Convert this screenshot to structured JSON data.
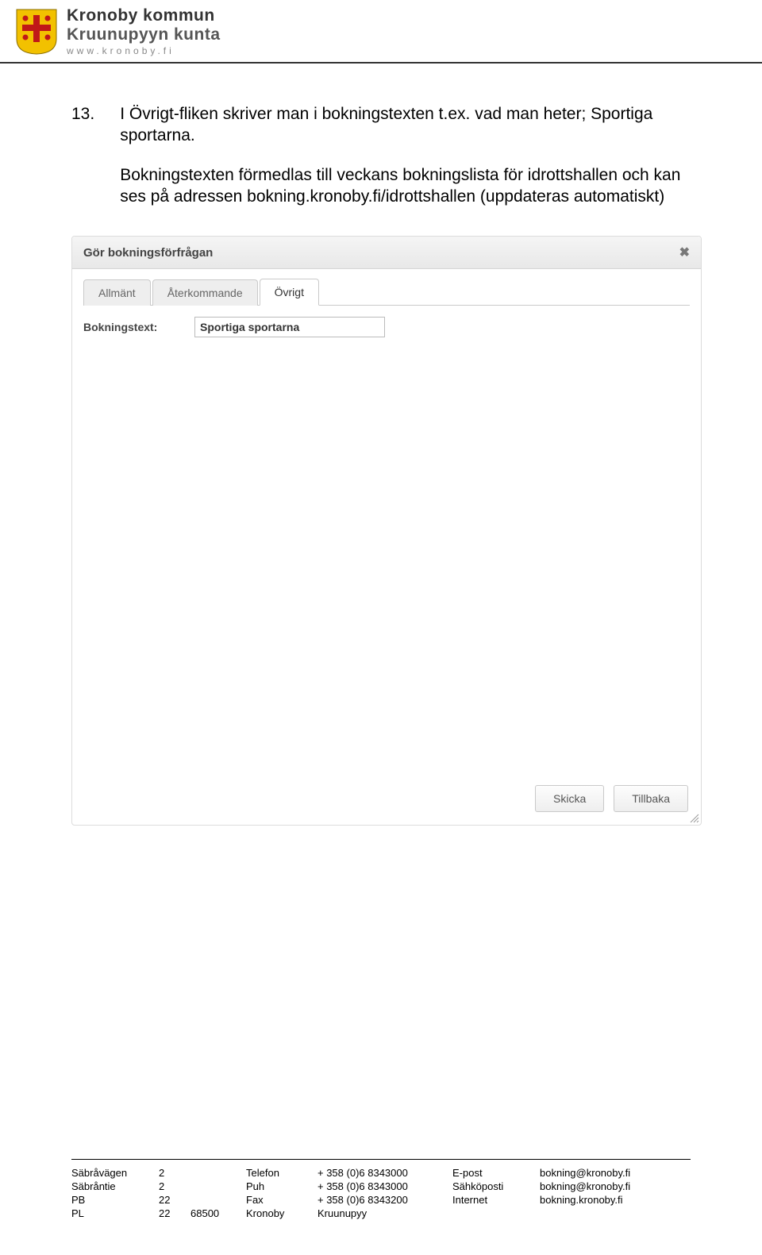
{
  "header": {
    "org_line1": "Kronoby kommun",
    "org_line2": "Kruunupyyn kunta",
    "url_spaced": "www.kronoby.fi"
  },
  "instruction": {
    "number": "13.",
    "para1": "I Övrigt-fliken skriver man i bokningstexten t.ex. vad man heter; Sportiga sportarna.",
    "para2": "Bokningstexten förmedlas till veckans bokningslista för idrottshallen och kan ses på adressen bokning.kronoby.fi/idrottshallen (uppdateras automatiskt)"
  },
  "dialog": {
    "title": "Gör bokningsförfrågan",
    "close_glyph": "✖",
    "tabs": {
      "allmant": "Allmänt",
      "aterkommande": "Återkommande",
      "ovrigt": "Övrigt"
    },
    "field_label": "Bokningstext:",
    "field_value": "Sportiga sportarna",
    "buttons": {
      "send": "Skicka",
      "back": "Tillbaka"
    }
  },
  "footer": {
    "rows": [
      {
        "c1": "Säbråvägen",
        "c2": "2",
        "c3": "",
        "c4": "Telefon",
        "c5": "+ 358 (0)6 8343000",
        "c6": "E-post",
        "c7": "bokning@kronoby.fi"
      },
      {
        "c1": "Säbråntie",
        "c2": "2",
        "c3": "",
        "c4": "Puh",
        "c5": "+ 358 (0)6 8343000",
        "c6": "Sähköposti",
        "c7": "bokning@kronoby.fi"
      },
      {
        "c1": "PB",
        "c2": "22",
        "c3": "",
        "c4": "Fax",
        "c5": "+ 358 (0)6 8343200",
        "c6": "Internet",
        "c7": "bokning.kronoby.fi"
      },
      {
        "c1": "PL",
        "c2": "22",
        "c3": "68500",
        "c4": "Kronoby",
        "c5": "Kruunupyy",
        "c6": "",
        "c7": ""
      }
    ]
  }
}
